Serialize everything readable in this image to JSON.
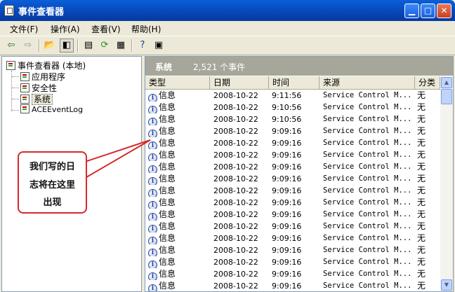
{
  "window": {
    "title": "事件查看器",
    "controls": [
      "minimize",
      "maximize",
      "close"
    ]
  },
  "menu": {
    "items": [
      "文件(F)",
      "操作(A)",
      "查看(V)",
      "帮助(H)"
    ]
  },
  "toolbar": {
    "icons": [
      "back-arrow-icon",
      "forward-arrow-icon",
      "up-folder-icon",
      "show-hide-tree-icon",
      "properties-icon",
      "refresh-icon",
      "export-list-icon",
      "help-icon",
      "show-pane-icon"
    ]
  },
  "tree": {
    "root": "事件查看器 (本地)",
    "children": [
      "应用程序",
      "安全性",
      "系统",
      "ACEEventLog"
    ],
    "selected": "系统"
  },
  "banner": {
    "title": "系统",
    "count": "2,521 个事件"
  },
  "table": {
    "columns": [
      "类型",
      "日期",
      "时间",
      "来源",
      "分类"
    ],
    "rows": [
      {
        "type": "信息",
        "date": "2008-10-22",
        "time": "9:11:56",
        "source": "Service Control M...",
        "category": "无"
      },
      {
        "type": "信息",
        "date": "2008-10-22",
        "time": "9:10:56",
        "source": "Service Control M...",
        "category": "无"
      },
      {
        "type": "信息",
        "date": "2008-10-22",
        "time": "9:10:56",
        "source": "Service Control M...",
        "category": "无"
      },
      {
        "type": "信息",
        "date": "2008-10-22",
        "time": "9:09:16",
        "source": "Service Control M...",
        "category": "无"
      },
      {
        "type": "信息",
        "date": "2008-10-22",
        "time": "9:09:16",
        "source": "Service Control M...",
        "category": "无"
      },
      {
        "type": "信息",
        "date": "2008-10-22",
        "time": "9:09:16",
        "source": "Service Control M...",
        "category": "无"
      },
      {
        "type": "信息",
        "date": "2008-10-22",
        "time": "9:09:16",
        "source": "Service Control M...",
        "category": "无"
      },
      {
        "type": "信息",
        "date": "2008-10-22",
        "time": "9:09:16",
        "source": "Service Control M...",
        "category": "无"
      },
      {
        "type": "信息",
        "date": "2008-10-22",
        "time": "9:09:16",
        "source": "Service Control M...",
        "category": "无"
      },
      {
        "type": "信息",
        "date": "2008-10-22",
        "time": "9:09:16",
        "source": "Service Control M...",
        "category": "无"
      },
      {
        "type": "信息",
        "date": "2008-10-22",
        "time": "9:09:16",
        "source": "Service Control M...",
        "category": "无"
      },
      {
        "type": "信息",
        "date": "2008-10-22",
        "time": "9:09:16",
        "source": "Service Control M...",
        "category": "无"
      },
      {
        "type": "信息",
        "date": "2008-10-22",
        "time": "9:09:16",
        "source": "Service Control M...",
        "category": "无"
      },
      {
        "type": "信息",
        "date": "2008-10-22",
        "time": "9:09:16",
        "source": "Service Control M...",
        "category": "无"
      },
      {
        "type": "信息",
        "date": "2008-10-22",
        "time": "9:09:16",
        "source": "Service Control M...",
        "category": "无"
      },
      {
        "type": "信息",
        "date": "2008-10-22",
        "time": "9:09:16",
        "source": "Service Control M...",
        "category": "无"
      },
      {
        "type": "信息",
        "date": "2008-10-22",
        "time": "9:09:16",
        "source": "Service Control M...",
        "category": "无"
      }
    ]
  },
  "annotation": {
    "lines": [
      "我们写的日",
      "志将在这里",
      "出现"
    ],
    "color": "#d42a2a"
  }
}
